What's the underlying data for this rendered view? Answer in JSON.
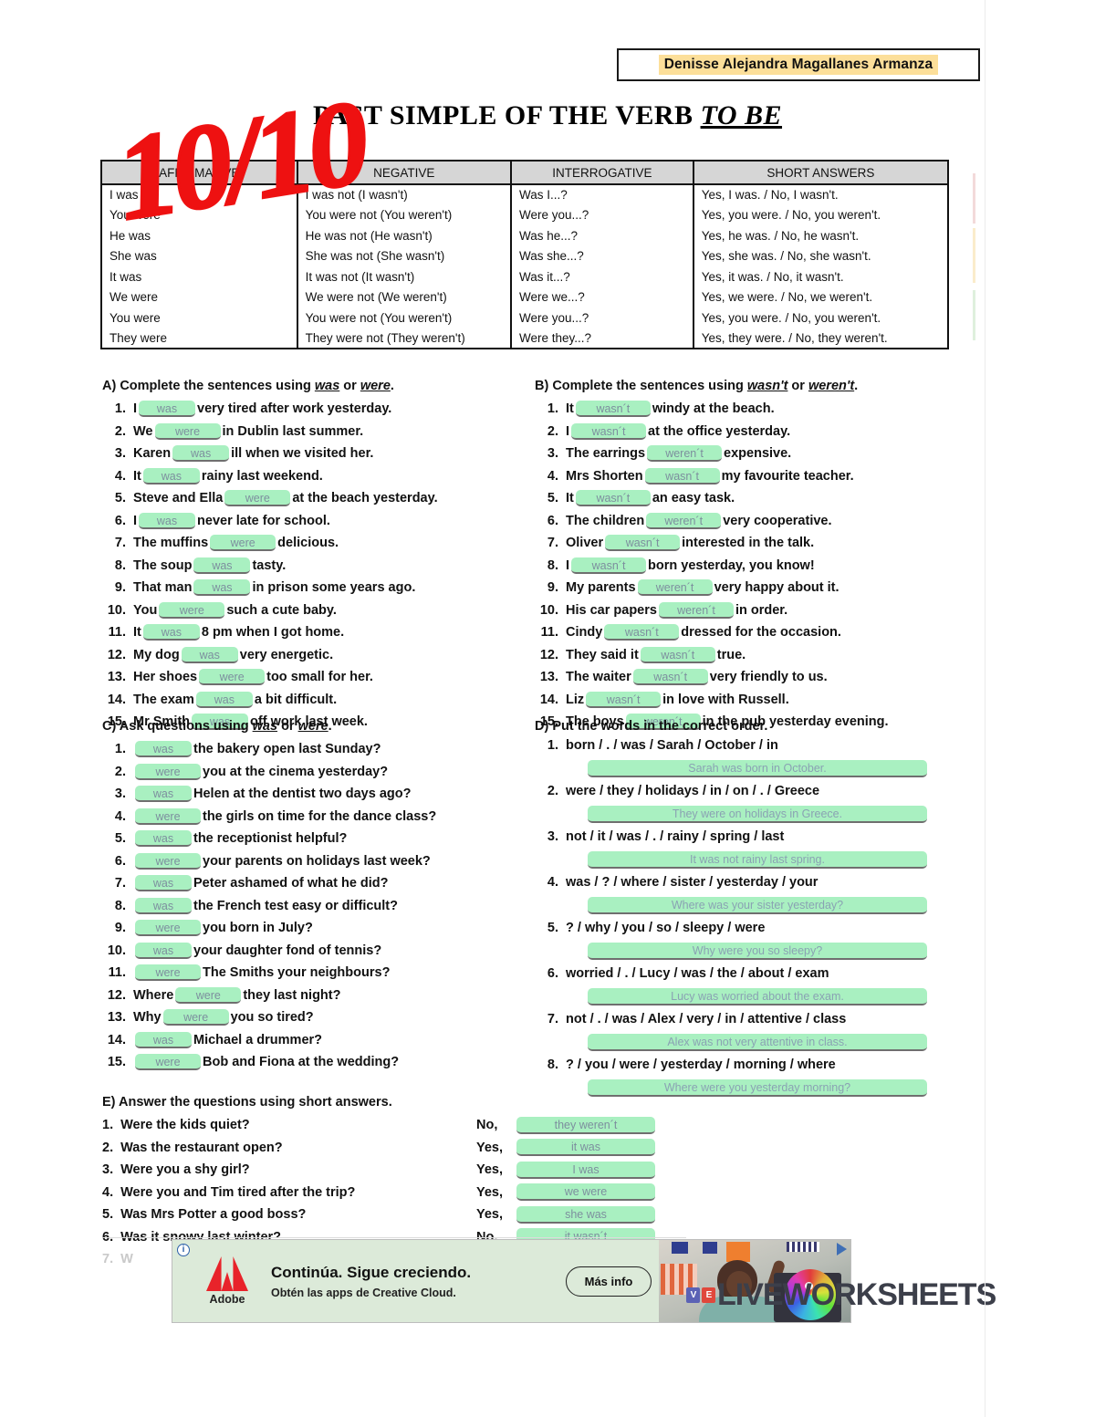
{
  "student_name": "Denisse Alejandra Magallanes Armanza",
  "title": {
    "main": "PAST SIMPLE OF THE VERB ",
    "emphasis": "TO BE"
  },
  "grade": "10/10",
  "grammar_table": {
    "headers": [
      "AFFIRMATIVE",
      "NEGATIVE",
      "INTERROGATIVE",
      "SHORT ANSWERS"
    ],
    "rows": [
      [
        "I was",
        "I was not (I wasn't)",
        "Was I...?",
        "Yes, I was. / No, I wasn't."
      ],
      [
        "You were",
        "You were not (You weren't)",
        "Were you...?",
        "Yes, you were. / No, you weren't."
      ],
      [
        "He was",
        "He was not (He wasn't)",
        "Was he...?",
        "Yes, he was. / No, he wasn't."
      ],
      [
        "She was",
        "She was not (She wasn't)",
        "Was she...?",
        "Yes, she was. / No, she wasn't."
      ],
      [
        "It was",
        "It was not (It wasn't)",
        "Was it...?",
        "Yes, it was. / No, it wasn't."
      ],
      [
        "We were",
        "We were not (We weren't)",
        "Were we...?",
        "Yes, we were. / No, we weren't."
      ],
      [
        "You were",
        "You were not (You weren't)",
        "Were you...?",
        "Yes, you were. / No, you weren't."
      ],
      [
        "They were",
        "They were not (They weren't)",
        "Were they...?",
        "Yes, they were. / No, they weren't."
      ]
    ]
  },
  "section_a": {
    "heading_pre": "A) Complete the sentences using ",
    "heading_em1": "was",
    "heading_mid": " or ",
    "heading_em2": "were",
    "heading_post": ".",
    "items": [
      {
        "n": "1.",
        "before": "I",
        "answer": "was",
        "after": "very tired after work yesterday."
      },
      {
        "n": "2.",
        "before": "We",
        "answer": "were",
        "after": "in Dublin last summer."
      },
      {
        "n": "3.",
        "before": "Karen",
        "answer": "was",
        "after": "ill when we visited her."
      },
      {
        "n": "4.",
        "before": "It",
        "answer": "was",
        "after": "rainy last weekend."
      },
      {
        "n": "5.",
        "before": "Steve and Ella",
        "answer": "were",
        "after": "at the beach yesterday."
      },
      {
        "n": "6.",
        "before": "I",
        "answer": "was",
        "after": "never late for school."
      },
      {
        "n": "7.",
        "before": "The muffins",
        "answer": "were",
        "after": "delicious."
      },
      {
        "n": "8.",
        "before": "The soup",
        "answer": "was",
        "after": "tasty."
      },
      {
        "n": "9.",
        "before": "That man",
        "answer": "was",
        "after": "in prison some years ago."
      },
      {
        "n": "10.",
        "before": "You",
        "answer": "were",
        "after": "such a cute baby."
      },
      {
        "n": "11.",
        "before": "It",
        "answer": "was",
        "after": "8 pm when I got home."
      },
      {
        "n": "12.",
        "before": "My dog",
        "answer": "was",
        "after": "very energetic."
      },
      {
        "n": "13.",
        "before": "Her shoes",
        "answer": "were",
        "after": "too small for her."
      },
      {
        "n": "14.",
        "before": "The exam",
        "answer": "was",
        "after": "a bit difficult."
      },
      {
        "n": "15.",
        "before": "Mr Smith",
        "answer": "was",
        "after": "off work last week."
      }
    ]
  },
  "section_b": {
    "heading_pre": "B) Complete the sentences using ",
    "heading_em1": "wasn't",
    "heading_mid": " or ",
    "heading_em2": "weren't",
    "heading_post": ".",
    "items": [
      {
        "n": "1.",
        "before": "It",
        "answer": "wasn´t",
        "after": "windy at the beach."
      },
      {
        "n": "2.",
        "before": "I",
        "answer": "wasn´t",
        "after": "at the office yesterday."
      },
      {
        "n": "3.",
        "before": "The earrings",
        "answer": "weren´t",
        "after": "expensive."
      },
      {
        "n": "4.",
        "before": "Mrs Shorten",
        "answer": "wasn´t",
        "after": "my favourite teacher."
      },
      {
        "n": "5.",
        "before": "It",
        "answer": "wasn´t",
        "after": "an easy task."
      },
      {
        "n": "6.",
        "before": "The children",
        "answer": "weren´t",
        "after": "very cooperative."
      },
      {
        "n": "7.",
        "before": "Oliver",
        "answer": "wasn´t",
        "after": "interested in the talk."
      },
      {
        "n": "8.",
        "before": "I",
        "answer": "wasn´t",
        "after": "born yesterday, you know!"
      },
      {
        "n": "9.",
        "before": "My parents",
        "answer": "weren´t",
        "after": "very happy about it."
      },
      {
        "n": "10.",
        "before": "His car papers",
        "answer": "weren´t",
        "after": "in order."
      },
      {
        "n": "11.",
        "before": "Cindy",
        "answer": "wasn´t",
        "after": "dressed for the occasion."
      },
      {
        "n": "12.",
        "before": "They said it",
        "answer": "wasn´t",
        "after": "true."
      },
      {
        "n": "13.",
        "before": "The waiter",
        "answer": "wasn´t",
        "after": "very friendly to us."
      },
      {
        "n": "14.",
        "before": "Liz",
        "answer": "wasn´t",
        "after": "in love with Russell."
      },
      {
        "n": "15.",
        "before": "The boys",
        "answer": "weren´t",
        "after": "in the pub yesterday evening."
      }
    ]
  },
  "section_c": {
    "heading_pre": "C) Ask questions using ",
    "heading_em1": "was",
    "heading_mid": " or ",
    "heading_em2": "were",
    "heading_post": ".",
    "items": [
      {
        "n": "1.",
        "before": "",
        "answer": "was",
        "after": "the bakery open last Sunday?"
      },
      {
        "n": "2.",
        "before": "",
        "answer": "were",
        "after": "you at the cinema yesterday?"
      },
      {
        "n": "3.",
        "before": "",
        "answer": "was",
        "after": "Helen at the dentist two days ago?"
      },
      {
        "n": "4.",
        "before": "",
        "answer": "were",
        "after": "the girls on time for the dance class?"
      },
      {
        "n": "5.",
        "before": "",
        "answer": "was",
        "after": "the receptionist helpful?"
      },
      {
        "n": "6.",
        "before": "",
        "answer": "were",
        "after": "your parents on holidays last week?"
      },
      {
        "n": "7.",
        "before": "",
        "answer": "was",
        "after": "Peter ashamed of what he did?"
      },
      {
        "n": "8.",
        "before": "",
        "answer": "was",
        "after": "the French test easy or difficult?"
      },
      {
        "n": "9.",
        "before": "",
        "answer": "were",
        "after": "you born in July?"
      },
      {
        "n": "10.",
        "before": "",
        "answer": "was",
        "after": "your daughter fond of tennis?"
      },
      {
        "n": "11.",
        "before": "",
        "answer": "were",
        "after": "The Smiths your neighbours?"
      },
      {
        "n": "12.",
        "before": "Where",
        "answer": "were",
        "after": "they last night?"
      },
      {
        "n": "13.",
        "before": "Why",
        "answer": "were",
        "after": "you so tired?"
      },
      {
        "n": "14.",
        "before": "",
        "answer": "was",
        "after": "Michael a drummer?"
      },
      {
        "n": "15.",
        "before": "",
        "answer": "were",
        "after": "Bob and Fiona at the wedding?"
      }
    ]
  },
  "section_d": {
    "heading": "D) Put the words in the correct order.",
    "items": [
      {
        "n": "1.",
        "prompt": "born / . / was / Sarah / October / in",
        "answer": "Sarah was born in October."
      },
      {
        "n": "2.",
        "prompt": "were / they / holidays / in / on / . / Greece",
        "answer": "They were on holidays in Greece."
      },
      {
        "n": "3.",
        "prompt": "not / it / was / . / rainy / spring / last",
        "answer": "It was not rainy last spring."
      },
      {
        "n": "4.",
        "prompt": "was / ? / where / sister / yesterday / your",
        "answer": "Where was your sister yesterday?"
      },
      {
        "n": "5.",
        "prompt": "? / why / you / so / sleepy / were",
        "answer": "Why were you so sleepy?"
      },
      {
        "n": "6.",
        "prompt": "worried / . / Lucy / was / the / about / exam",
        "answer": "Lucy was worried about the exam."
      },
      {
        "n": "7.",
        "prompt": "not / . / was / Alex / very / in / attentive / class",
        "answer": "Alex was not very attentive in class."
      },
      {
        "n": "8.",
        "prompt": "? / you / were / yesterday / morning / where",
        "answer": "Where were you yesterday morning?"
      }
    ]
  },
  "section_e": {
    "heading": "E) Answer the questions using short answers.",
    "items": [
      {
        "n": "1.",
        "question": "Were the kids quiet?",
        "yn": "No,",
        "answer": "they weren´t"
      },
      {
        "n": "2.",
        "question": "Was the restaurant open?",
        "yn": "Yes,",
        "answer": "it was"
      },
      {
        "n": "3.",
        "question": "Were you a shy girl?",
        "yn": "Yes,",
        "answer": "I was"
      },
      {
        "n": "4.",
        "question": "Were you and Tim tired after the trip?",
        "yn": "Yes,",
        "answer": "we were"
      },
      {
        "n": "5.",
        "question": "Was Mrs Potter a good boss?",
        "yn": "Yes,",
        "answer": "she was"
      },
      {
        "n": "6.",
        "question": "Was it snowy last winter?",
        "yn": "No,",
        "answer": "it wasn´t"
      },
      {
        "n": "7.",
        "question": "W",
        "yn": "",
        "answer": ""
      }
    ]
  },
  "ad": {
    "brand": "Adobe",
    "headline": "Continúa. Sigue creciendo.",
    "subline": "Obtén las apps de Creative Cloud.",
    "cta": "Más info",
    "info_glyph": "i"
  },
  "watermark": {
    "badge1": "V",
    "badge2": "E",
    "text": "LIVEWORKSHEETS"
  },
  "colors": {
    "answer_fill": "#a9f0c1",
    "answer_text": "#7d8f9e",
    "grade_red": "#ee1111",
    "name_highlight": "#fcdf9a",
    "table_header": "#d6d6d6"
  }
}
